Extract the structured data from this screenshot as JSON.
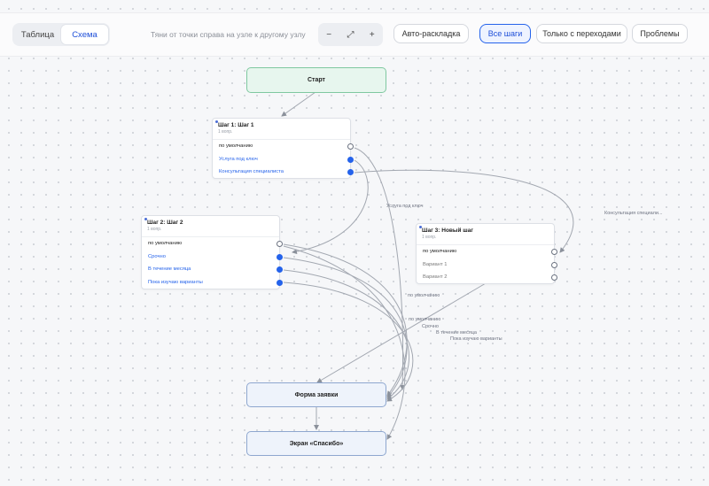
{
  "toolbar": {
    "view_tabs": [
      "Таблица",
      "Схема"
    ],
    "active_view": "Схема",
    "hint": "Тяни от точки справа на узле к другому узлу",
    "zoom_out": "−",
    "zoom_fit": "⤢",
    "zoom_in": "+",
    "auto_layout": "Авто-раскладка",
    "filters": [
      "Все шаги",
      "Только с переходами",
      "Проблемы"
    ],
    "active_filter": "Все шаги"
  },
  "nodes": {
    "start": {
      "label": "Старт"
    },
    "step1": {
      "title": "Шаг 1: Шаг 1",
      "subtitle": "1 вопр.",
      "options": [
        "по умолчанию",
        "Услуга под ключ",
        "Консультация специалиста"
      ]
    },
    "step2": {
      "title": "Шаг 2: Шаг 2",
      "subtitle": "1 вопр.",
      "options": [
        "по умолчанию",
        "Срочно",
        "В течение месяца",
        "Пока изучаю варианты"
      ]
    },
    "step3": {
      "title": "Шаг 3: Новый шаг",
      "subtitle": "1 вопр.",
      "options": [
        "по умолчанию",
        "Вариант 1",
        "Вариант 2"
      ]
    },
    "form": {
      "label": "Форма заявки"
    },
    "thanks": {
      "label": "Экран «Спасибо»"
    }
  },
  "edge_labels": {
    "service": "Услуга под ключ",
    "consult": "Консультация специали...",
    "default_a": "по умолчанию",
    "default_b": "по умолчанию",
    "urgent": "Срочно",
    "month": "В течение месяца",
    "exploring": "Пока изучаю варианты"
  },
  "colors": {
    "accent": "#2563eb",
    "start_bg": "#e7f6ee",
    "start_border": "#7fc8a0",
    "terminal_bg": "#eef3fb",
    "edge": "#9aa0a9"
  }
}
